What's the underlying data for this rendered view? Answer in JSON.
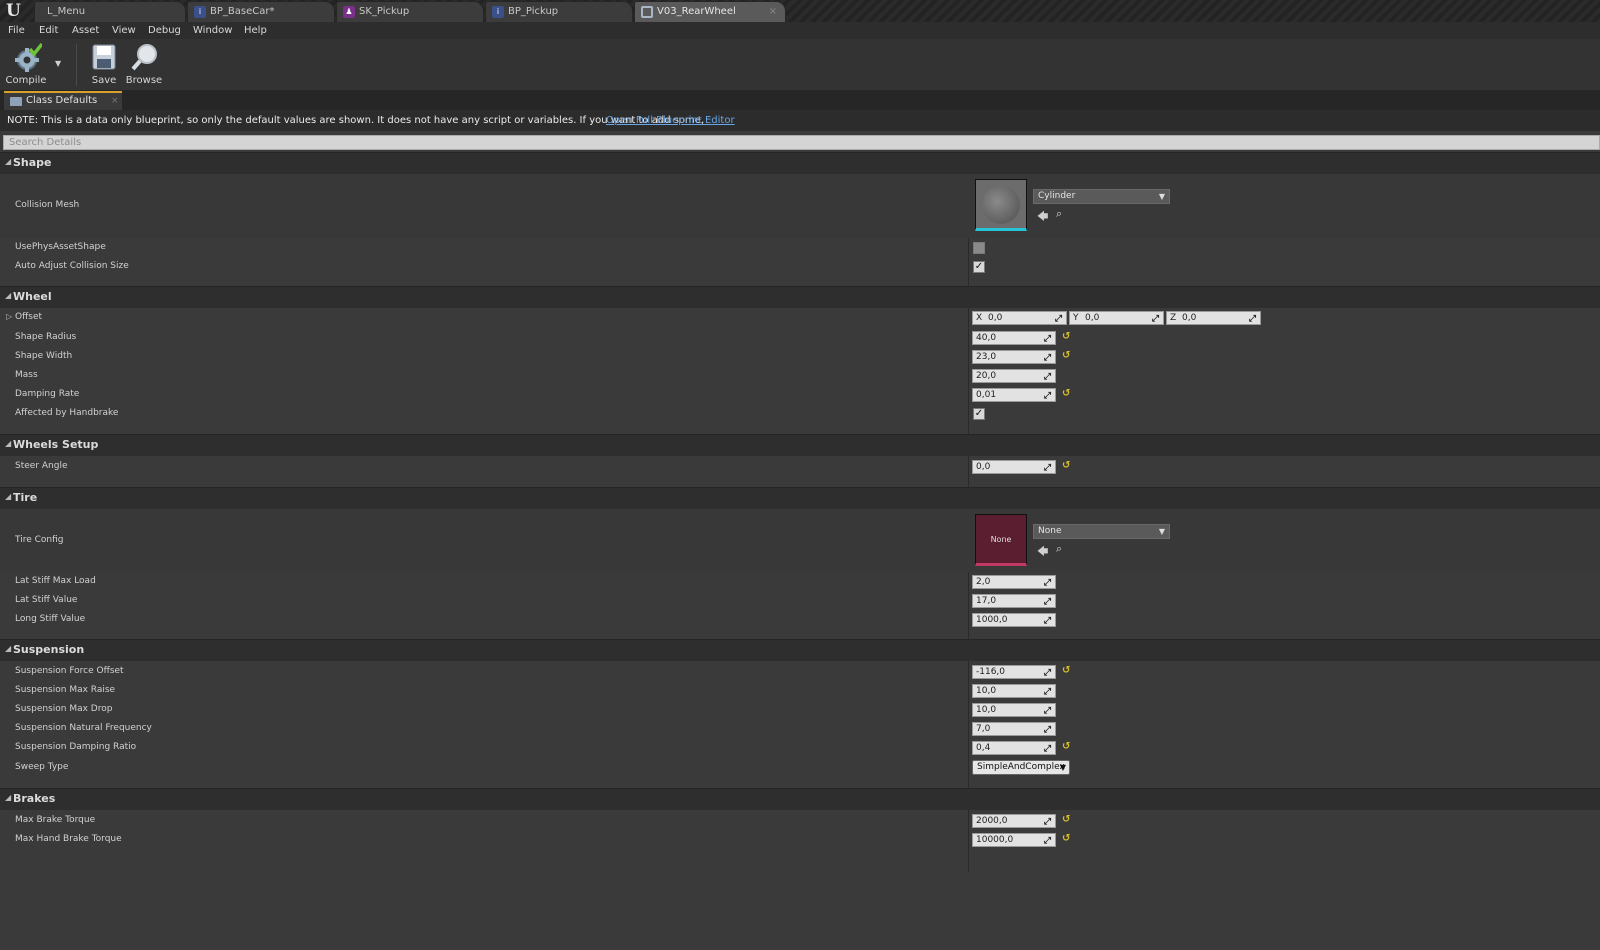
{
  "tabs": [
    {
      "label": "L_Menu",
      "icon": "level-icon"
    },
    {
      "label": "BP_BaseCar*",
      "icon": "blueprint-icon"
    },
    {
      "label": "SK_Pickup",
      "icon": "skeletal-mesh-icon"
    },
    {
      "label": "BP_Pickup",
      "icon": "blueprint-icon"
    },
    {
      "label": "V03_RearWheel",
      "icon": "wheel-icon"
    }
  ],
  "menu": [
    "File",
    "Edit",
    "Asset",
    "View",
    "Debug",
    "Window",
    "Help"
  ],
  "toolbar": {
    "compile": "Compile",
    "save": "Save",
    "browse": "Browse"
  },
  "panel_tab": "Class Defaults",
  "note": {
    "text": "NOTE: This is a data only blueprint, so only the default values are shown.  It does not have any script or variables.  If you want to add some,",
    "link": "Open Full Blueprint Editor"
  },
  "search_placeholder": "Search Details",
  "shape": {
    "header": "Shape",
    "collision_mesh_label": "Collision Mesh",
    "collision_mesh_value": "Cylinder",
    "use_phys_label": "UsePhysAssetShape",
    "use_phys_checked": false,
    "auto_adjust_label": "Auto Adjust Collision Size",
    "auto_adjust_checked": true
  },
  "wheel": {
    "header": "Wheel",
    "offset_label": "Offset",
    "offset": {
      "x": "0,0",
      "y": "0,0",
      "z": "0,0"
    },
    "shape_radius_label": "Shape Radius",
    "shape_radius": "40,0",
    "shape_width_label": "Shape Width",
    "shape_width": "23,0",
    "mass_label": "Mass",
    "mass": "20,0",
    "damping_label": "Damping Rate",
    "damping": "0,01",
    "handbrake_label": "Affected by Handbrake",
    "handbrake_checked": true
  },
  "wheels_setup": {
    "header": "Wheels Setup",
    "steer_label": "Steer Angle",
    "steer": "0,0"
  },
  "tire": {
    "header": "Tire",
    "config_label": "Tire Config",
    "config_value": "None",
    "thumb_text": "None",
    "lat_max_label": "Lat Stiff Max Load",
    "lat_max": "2,0",
    "lat_val_label": "Lat Stiff Value",
    "lat_val": "17,0",
    "long_label": "Long Stiff Value",
    "long_val": "1000,0"
  },
  "suspension": {
    "header": "Suspension",
    "force_label": "Suspension Force Offset",
    "force": "-116,0",
    "raise_label": "Suspension Max Raise",
    "raise": "10,0",
    "drop_label": "Suspension Max Drop",
    "drop": "10,0",
    "freq_label": "Suspension Natural Frequency",
    "freq": "7,0",
    "ratio_label": "Suspension Damping Ratio",
    "ratio": "0,4",
    "sweep_label": "Sweep Type",
    "sweep": "SimpleAndComplex"
  },
  "brakes": {
    "header": "Brakes",
    "brake_label": "Max Brake Torque",
    "brake": "2000,0",
    "hand_label": "Max Hand Brake Torque",
    "hand": "10000,0"
  },
  "colors": {
    "accent_tab": "#d6a22d",
    "link": "#6aa6e4",
    "reset_arrow": "#d9c12d",
    "mesh_underline": "#26c4d8",
    "tire_underline": "#c23a64"
  }
}
